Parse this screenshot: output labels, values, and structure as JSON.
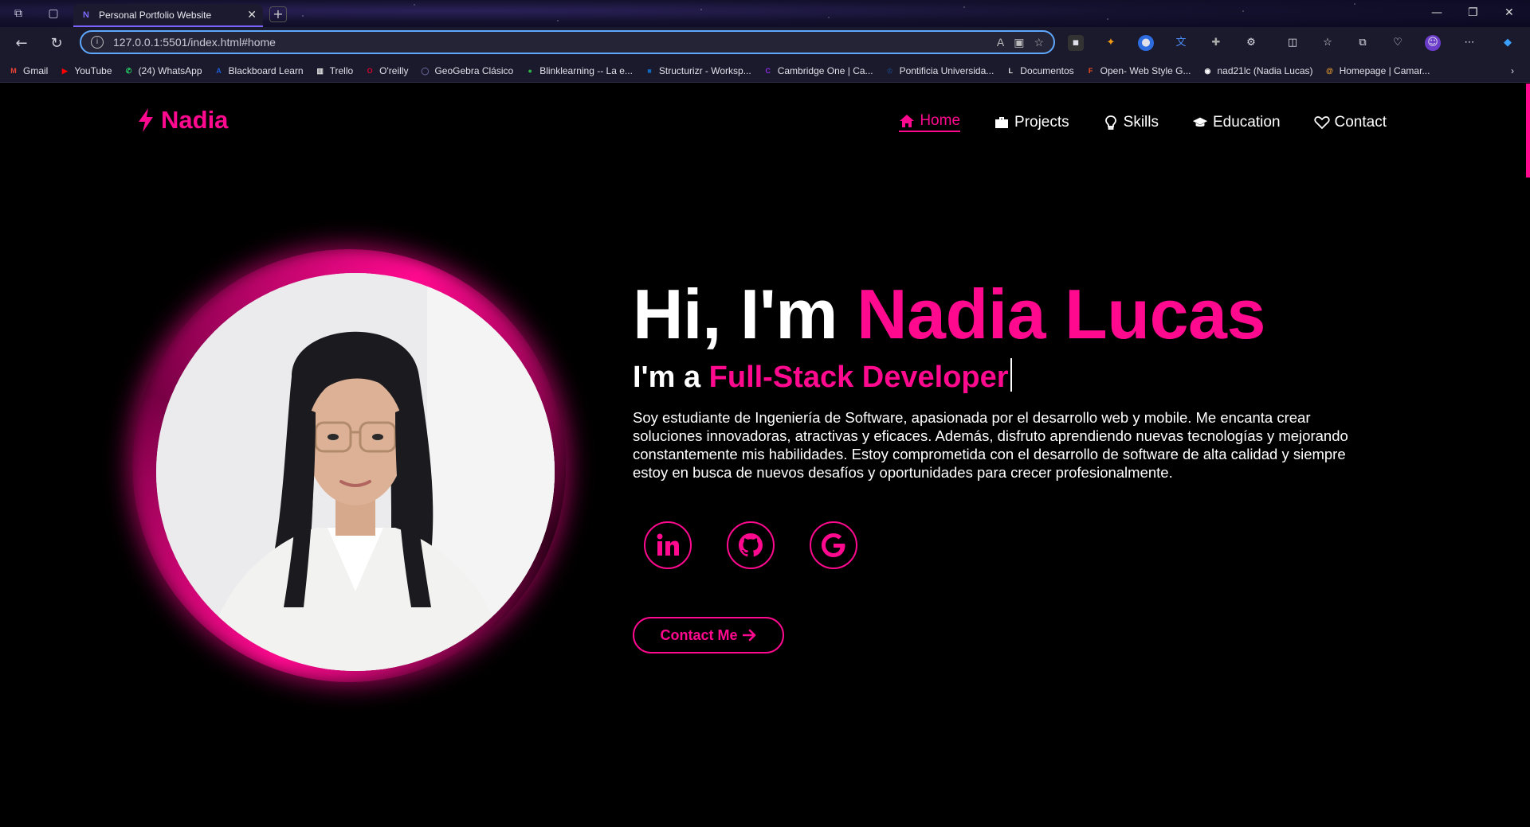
{
  "browser": {
    "tab_title": "Personal Portfolio Website",
    "tab_favicon": "N",
    "url": "127.0.0.1:5501/index.html#home",
    "bookmarks": [
      {
        "label": "Gmail",
        "icon": "M",
        "color": "#ea4335"
      },
      {
        "label": "YouTube",
        "icon": "▶",
        "color": "#ff0000"
      },
      {
        "label": "(24) WhatsApp",
        "icon": "✆",
        "color": "#25d366"
      },
      {
        "label": "Blackboard Learn",
        "icon": "A",
        "color": "#1e5cd6"
      },
      {
        "label": "Trello",
        "icon": "▥",
        "color": "#e8e8e8"
      },
      {
        "label": "O'reilly",
        "icon": "O",
        "color": "#d3002d"
      },
      {
        "label": "GeoGebra Clásico",
        "icon": "◯",
        "color": "#666699"
      },
      {
        "label": "Blinklearning -- La e...",
        "icon": "●",
        "color": "#2fb44b"
      },
      {
        "label": "Structurizr - Worksp...",
        "icon": "■",
        "color": "#1168bd"
      },
      {
        "label": "Cambridge One | Ca...",
        "icon": "C",
        "color": "#8a2be2"
      },
      {
        "label": "Pontificia Universida...",
        "icon": "♔",
        "color": "#1b3a6b"
      },
      {
        "label": "Documentos",
        "icon": "L",
        "color": "#e6e6e6"
      },
      {
        "label": "Open- Web Style G...",
        "icon": "F",
        "color": "#f24e1e"
      },
      {
        "label": "nad21lc (Nadia Lucas)",
        "icon": "◉",
        "color": "#ffffff"
      },
      {
        "label": "Homepage | Camar...",
        "icon": "@",
        "color": "#f0a030"
      }
    ]
  },
  "nav": {
    "logo": "Nadia",
    "items": [
      {
        "label": "Home",
        "icon": "home-icon"
      },
      {
        "label": "Projects",
        "icon": "briefcase-icon"
      },
      {
        "label": "Skills",
        "icon": "lightbulb-icon"
      },
      {
        "label": "Education",
        "icon": "graduation-cap-icon"
      },
      {
        "label": "Contact",
        "icon": "heart-icon"
      }
    ],
    "active": "Home"
  },
  "hero": {
    "greeting": "Hi, I'm ",
    "name": "Nadia Lucas",
    "role_prefix": "I'm a ",
    "role": "Full-Stack Developer",
    "bio": "Soy estudiante de Ingeniería de Software, apasionada por el desarrollo web y mobile. Me encanta crear soluciones innovadoras, atractivas y eficaces. Además, disfruto aprendiendo nuevas tecnologías y mejorando constantemente mis habilidades. Estoy comprometida con el desarrollo de software de alta calidad y siempre estoy en busca de nuevos desafíos y oportunidades para crecer profesionalmente.",
    "socials": [
      "linkedin-icon",
      "github-icon",
      "google-icon"
    ],
    "cta_label": "Contact Me"
  },
  "colors": {
    "accent": "#ff0a8f",
    "background": "#000000"
  }
}
